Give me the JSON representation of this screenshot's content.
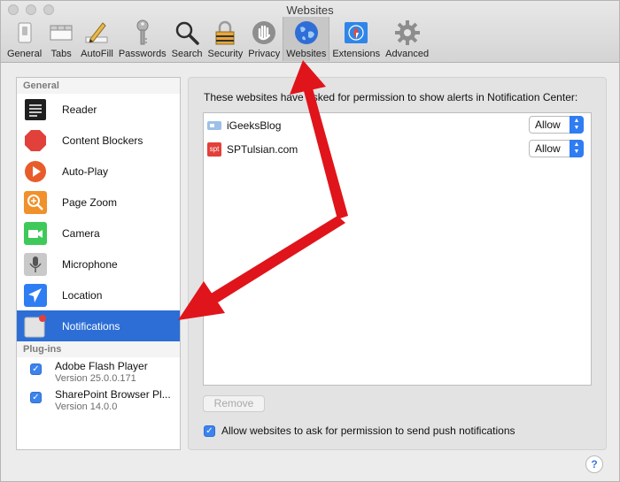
{
  "window": {
    "title": "Websites"
  },
  "toolbar": {
    "items": [
      {
        "label": "General",
        "icon": "switch-icon"
      },
      {
        "label": "Tabs",
        "icon": "tabs-icon"
      },
      {
        "label": "AutoFill",
        "icon": "pencil-icon"
      },
      {
        "label": "Passwords",
        "icon": "key-icon"
      },
      {
        "label": "Search",
        "icon": "magnifier-icon"
      },
      {
        "label": "Security",
        "icon": "padlock-icon"
      },
      {
        "label": "Privacy",
        "icon": "hand-icon"
      },
      {
        "label": "Websites",
        "icon": "globe-icon",
        "selected": true
      },
      {
        "label": "Extensions",
        "icon": "puzzle-icon"
      },
      {
        "label": "Advanced",
        "icon": "gear-icon"
      }
    ]
  },
  "sidebar": {
    "general_header": "General",
    "items": [
      {
        "label": "Reader",
        "color": "#2b2b2b"
      },
      {
        "label": "Content Blockers",
        "color": "#e2403a"
      },
      {
        "label": "Auto-Play",
        "color": "#e85c2c"
      },
      {
        "label": "Page Zoom",
        "color": "#f0912c"
      },
      {
        "label": "Camera",
        "color": "#3fc95a"
      },
      {
        "label": "Microphone",
        "color": "#b9b9b9"
      },
      {
        "label": "Location",
        "color": "#2f7df3"
      },
      {
        "label": "Notifications",
        "color": "#d9d9d9",
        "selected": true
      }
    ],
    "plugins_header": "Plug-ins",
    "plugins": [
      {
        "name": "Adobe Flash Player",
        "version": "Version 25.0.0.171",
        "checked": true
      },
      {
        "name": "SharePoint Browser Pl...",
        "version": "Version 14.0.0",
        "checked": true
      }
    ]
  },
  "main": {
    "description": "These websites have asked for permission to show alerts in Notification Center:",
    "sites": [
      {
        "name": "iGeeksBlog",
        "permission": "Allow"
      },
      {
        "name": "SPTulsian.com",
        "permission": "Allow",
        "favicon_text": "spt"
      }
    ],
    "remove_label": "Remove",
    "allow_push_label": "Allow websites to ask for permission to send push notifications",
    "allow_push_checked": true
  },
  "help_label": "?",
  "colors": {
    "accent": "#2c6ed6",
    "annotation_arrow": "#e0141b"
  }
}
